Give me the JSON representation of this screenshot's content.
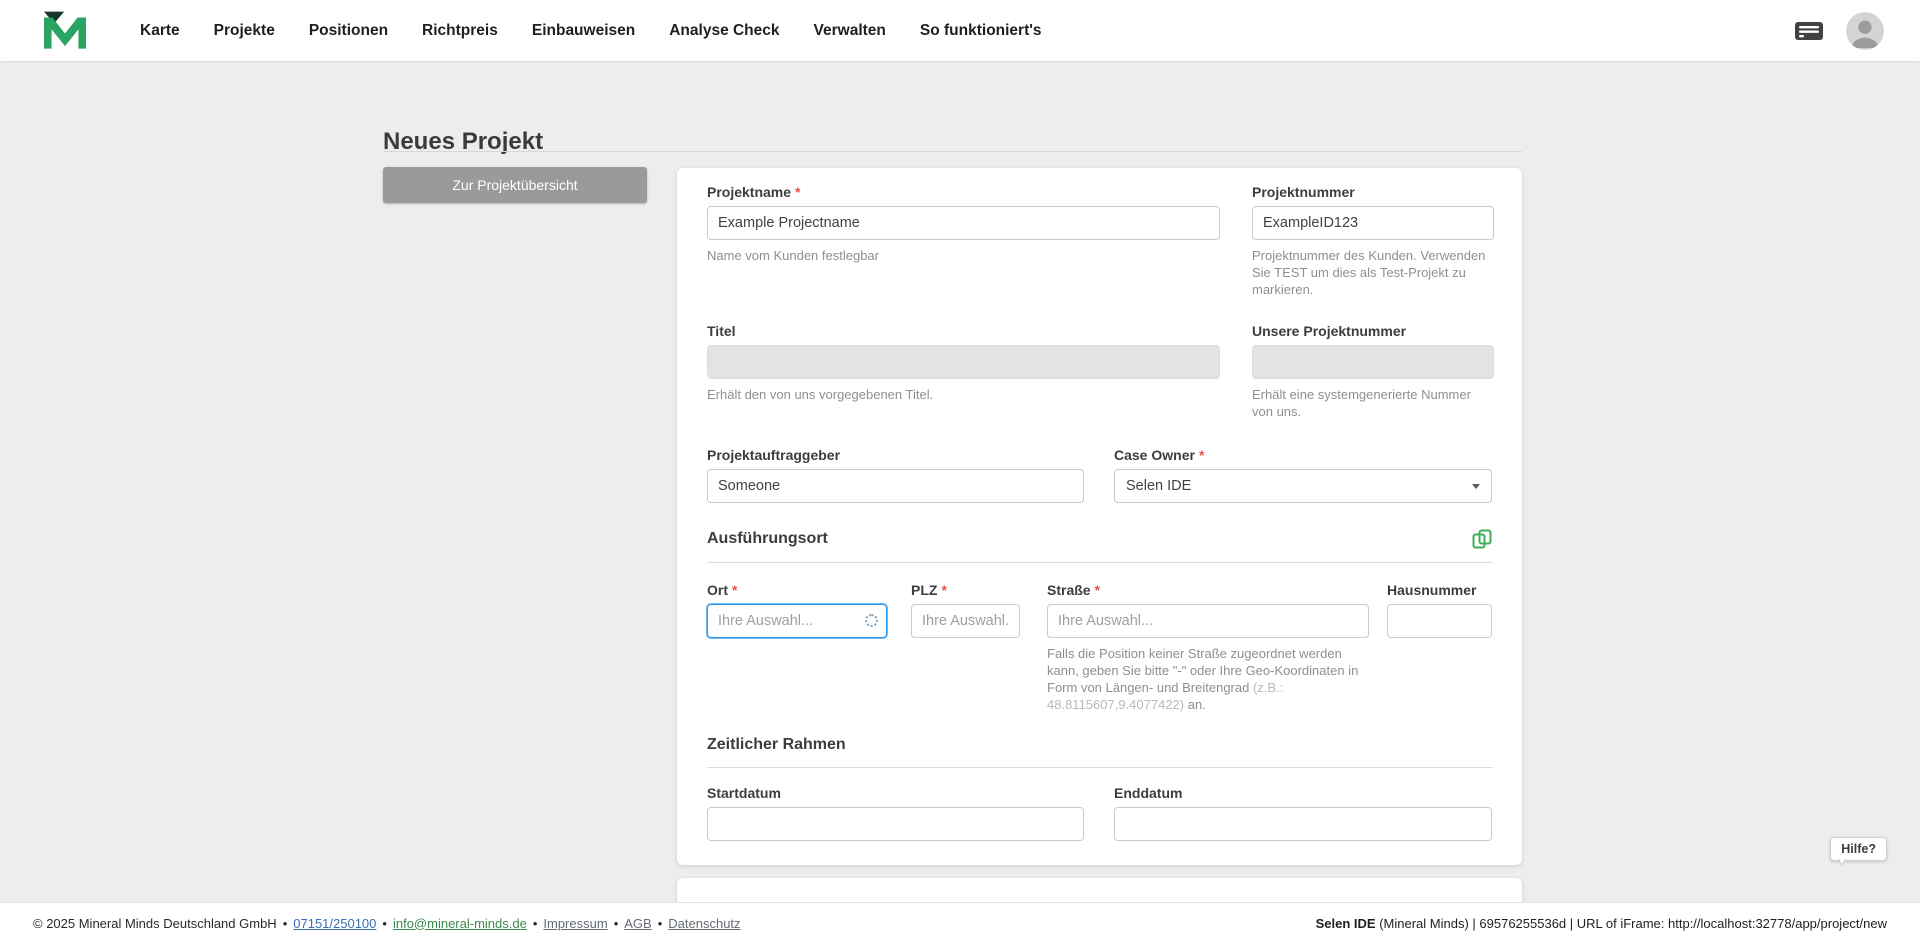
{
  "ui": {
    "required_marker": "*",
    "accent_green": "#3fae57",
    "focus_blue": "#2196f3",
    "button_gray": "#9a9a9a",
    "required_red": "#e5544b"
  },
  "nav": {
    "items": [
      {
        "label": "Karte"
      },
      {
        "label": "Projekte"
      },
      {
        "label": "Positionen"
      },
      {
        "label": "Richtpreis"
      },
      {
        "label": "Einbauweisen"
      },
      {
        "label": "Analyse Check"
      },
      {
        "label": "Verwalten"
      },
      {
        "label": "So funktioniert's"
      }
    ]
  },
  "page": {
    "title": "Neues Projekt",
    "back_button_label": "Zur Projektübersicht"
  },
  "form": {
    "projektname": {
      "label": "Projektname",
      "value": "Example Projectname",
      "helper": "Name vom Kunden festlegbar"
    },
    "projektnummer": {
      "label": "Projektnummer",
      "value": "ExampleID123",
      "helper": "Projektnummer des Kunden. Verwenden Sie TEST um dies als Test-Projekt zu markieren."
    },
    "titel": {
      "label": "Titel",
      "value": "",
      "helper": "Erhält den von uns vorgegebenen Titel."
    },
    "unsere_projektnummer": {
      "label": "Unsere Projektnummer",
      "value": "",
      "helper": "Erhält eine systemgenerierte Nummer von uns."
    },
    "projektauftraggeber": {
      "label": "Projektauftraggeber",
      "value": "Someone"
    },
    "case_owner": {
      "label": "Case Owner",
      "value": "Selen IDE"
    },
    "sections": {
      "ausfuehrungsort": "Ausführungsort",
      "zeitlicher_rahmen": "Zeitlicher Rahmen"
    },
    "ort": {
      "label": "Ort",
      "placeholder": "Ihre Auswahl...",
      "loading": true
    },
    "plz": {
      "label": "PLZ",
      "placeholder": "Ihre Auswahl."
    },
    "strasse": {
      "label": "Straße",
      "placeholder": "Ihre Auswahl...",
      "helper_part1": "Falls die Position keiner Straße zugeordnet werden kann, geben Sie bitte \"-\" oder Ihre Geo-Koordinaten in Form von Längen- und Breitengrad ",
      "helper_part2": "(z.B.: 48.8115607,9.4077422)",
      "helper_part3": " an."
    },
    "hausnummer": {
      "label": "Hausnummer",
      "value": ""
    },
    "startdatum": {
      "label": "Startdatum",
      "value": ""
    },
    "enddatum": {
      "label": "Enddatum",
      "value": ""
    }
  },
  "help_button": {
    "label": "Hilfe?"
  },
  "footer": {
    "copyright": "© 2025 Mineral Minds Deutschland GmbH",
    "separator": "•",
    "links": [
      {
        "label": "07151/250100"
      },
      {
        "label": "info@mineral-minds.de"
      },
      {
        "label": "Impressum"
      },
      {
        "label": "AGB"
      },
      {
        "label": "Datenschutz"
      }
    ],
    "session_bold": "Selen IDE",
    "session_rest": " (Mineral Minds) | 69576255536d | URL of iFrame: http://localhost:32778/app/project/new"
  }
}
